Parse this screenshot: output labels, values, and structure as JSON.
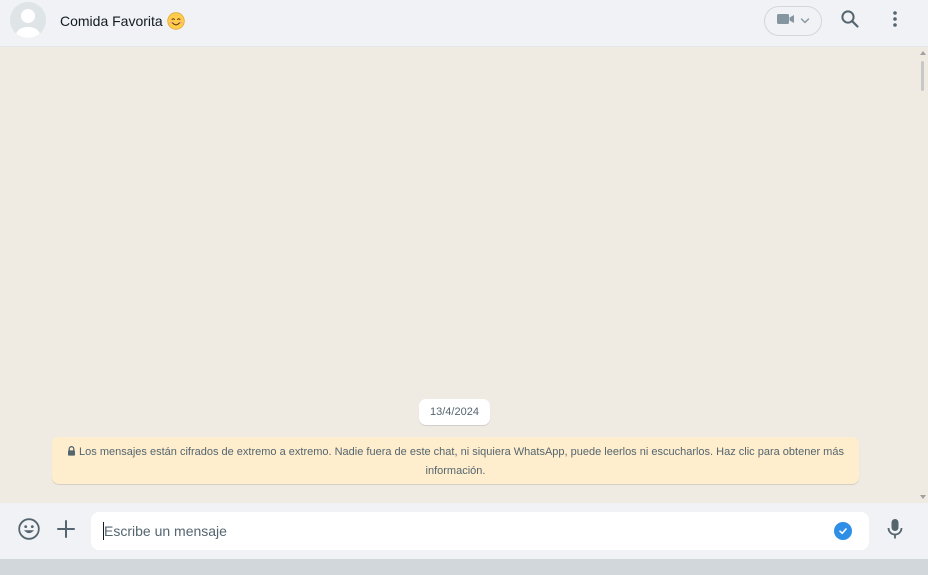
{
  "header": {
    "chat_name": "Comida Favorita",
    "chat_emoji": "smiling-face-with-smiling-eyes",
    "icons": [
      "avatar-placeholder",
      "video-call-icon",
      "chevron-down-icon",
      "search-icon",
      "menu-icon"
    ]
  },
  "messages": {
    "date_chip": "13/4/2024",
    "encryption_notice": "Los mensajes están cifrados de extremo a extremo. Nadie fuera de este chat, ni siquiera WhatsApp, puede leerlos ni escucharlos. Haz clic para obtener más información.",
    "icons": [
      "lock-icon"
    ]
  },
  "composer": {
    "placeholder": "Escribe un mensaje",
    "value": "",
    "icons": [
      "emoji-icon",
      "plus-icon",
      "check-badge-icon",
      "microphone-icon"
    ]
  },
  "colors": {
    "header_bg": "#f0f2f5",
    "chat_bg": "#efeae2",
    "notice_bg": "#ffeecd",
    "accent_blue": "#2f8ee6",
    "text_primary": "#111b21",
    "text_secondary": "#54656f"
  }
}
